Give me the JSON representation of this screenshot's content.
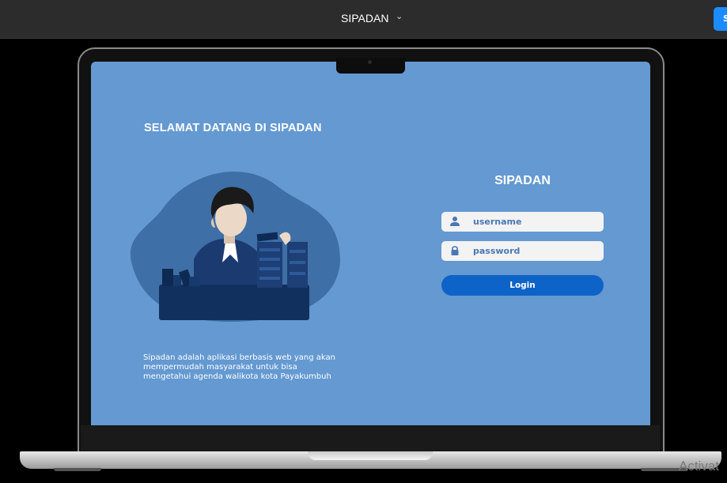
{
  "topbar": {
    "title": "SIPADAN",
    "chevron": "⌄",
    "share_label": "S"
  },
  "hero": {
    "welcome": "SELAMAT DATANG DI SIPADAN",
    "description": "Sipadan adalah  aplikasi berbasis web yang akan mempermudah masyarakat untuk bisa mengetahui agenda walikota kota Payakumbuh"
  },
  "login": {
    "title": "SIPADAN",
    "username_placeholder": "username",
    "password_placeholder": "password",
    "button_label": "Login"
  },
  "watermark": "Activat",
  "colors": {
    "screen_bg": "#6499d1",
    "button": "#0d63c7",
    "topbar": "#2c2c2c"
  },
  "icons": {
    "username": "user-icon",
    "password": "lock-icon"
  }
}
